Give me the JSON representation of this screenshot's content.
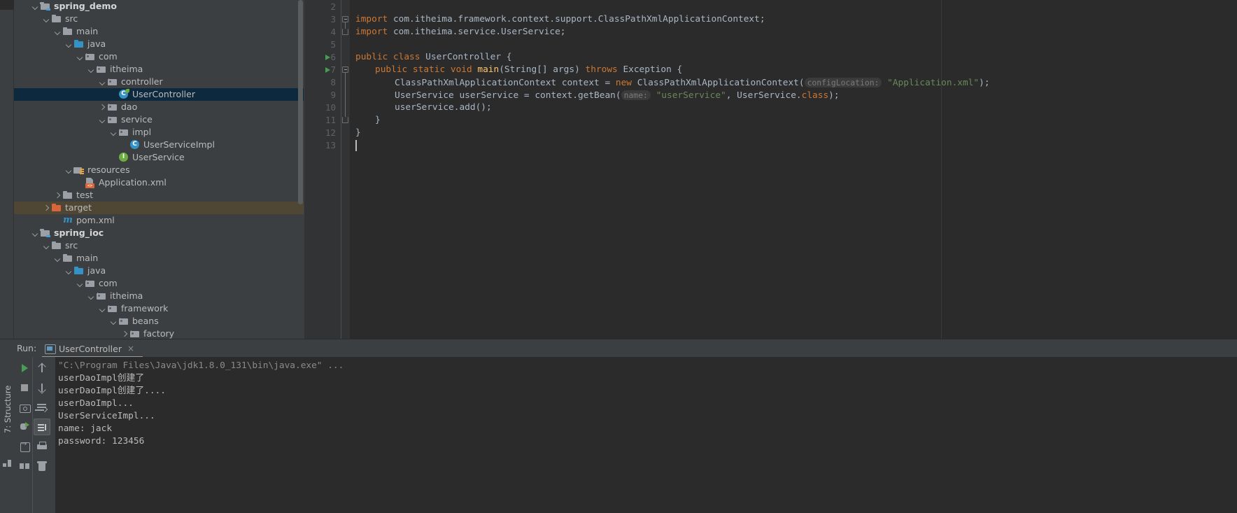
{
  "window": {
    "theme_bg": "#3c3f41",
    "editor_bg": "#2b2b2b",
    "selection_color": "#0d293e",
    "accent_blue": "#3592c4",
    "accent_green": "#6cae3e",
    "accent_orange": "#d9663a"
  },
  "project_tree": {
    "items": [
      {
        "label": "spring_demo",
        "indent": 0,
        "arrow": "down",
        "icon": "module-folder-icon",
        "bold": true,
        "state": "normal"
      },
      {
        "label": "src",
        "indent": 1,
        "arrow": "down",
        "icon": "folder-icon",
        "bold": false,
        "state": "normal"
      },
      {
        "label": "main",
        "indent": 2,
        "arrow": "down",
        "icon": "folder-icon",
        "bold": false,
        "state": "normal"
      },
      {
        "label": "java",
        "indent": 3,
        "arrow": "down",
        "icon": "source-root-icon",
        "bold": false,
        "state": "normal"
      },
      {
        "label": "com",
        "indent": 4,
        "arrow": "down",
        "icon": "package-icon",
        "bold": false,
        "state": "normal"
      },
      {
        "label": "itheima",
        "indent": 5,
        "arrow": "down",
        "icon": "package-icon",
        "bold": false,
        "state": "normal"
      },
      {
        "label": "controller",
        "indent": 6,
        "arrow": "down",
        "icon": "package-icon",
        "bold": false,
        "state": "normal"
      },
      {
        "label": "UserController",
        "indent": 7,
        "arrow": "none",
        "icon": "java-class-spring-icon",
        "bold": false,
        "state": "selected"
      },
      {
        "label": "dao",
        "indent": 6,
        "arrow": "right",
        "icon": "package-icon",
        "bold": false,
        "state": "normal"
      },
      {
        "label": "service",
        "indent": 6,
        "arrow": "down",
        "icon": "package-icon",
        "bold": false,
        "state": "normal"
      },
      {
        "label": "impl",
        "indent": 7,
        "arrow": "down",
        "icon": "package-icon",
        "bold": false,
        "state": "normal"
      },
      {
        "label": "UserServiceImpl",
        "indent": 8,
        "arrow": "none",
        "icon": "java-class-icon",
        "bold": false,
        "state": "normal"
      },
      {
        "label": "UserService",
        "indent": 7,
        "arrow": "none",
        "icon": "java-interface-icon",
        "bold": false,
        "state": "normal"
      },
      {
        "label": "resources",
        "indent": 3,
        "arrow": "down",
        "icon": "resources-folder-icon",
        "bold": false,
        "state": "normal"
      },
      {
        "label": "Application.xml",
        "indent": 4,
        "arrow": "none",
        "icon": "xml-file-icon",
        "bold": false,
        "state": "normal"
      },
      {
        "label": "test",
        "indent": 2,
        "arrow": "right",
        "icon": "folder-icon",
        "bold": false,
        "state": "normal"
      },
      {
        "label": "target",
        "indent": 1,
        "arrow": "right",
        "icon": "target-folder-icon",
        "bold": false,
        "state": "excluded"
      },
      {
        "label": "pom.xml",
        "indent": 2,
        "arrow": "none",
        "icon": "maven-pom-icon",
        "bold": false,
        "state": "normal"
      },
      {
        "label": "spring_ioc",
        "indent": 0,
        "arrow": "down",
        "icon": "module-folder-icon",
        "bold": true,
        "state": "normal"
      },
      {
        "label": "src",
        "indent": 1,
        "arrow": "down",
        "icon": "folder-icon",
        "bold": false,
        "state": "normal"
      },
      {
        "label": "main",
        "indent": 2,
        "arrow": "down",
        "icon": "folder-icon",
        "bold": false,
        "state": "normal"
      },
      {
        "label": "java",
        "indent": 3,
        "arrow": "down",
        "icon": "source-root-icon",
        "bold": false,
        "state": "normal"
      },
      {
        "label": "com",
        "indent": 4,
        "arrow": "down",
        "icon": "package-icon",
        "bold": false,
        "state": "normal"
      },
      {
        "label": "itheima",
        "indent": 5,
        "arrow": "down",
        "icon": "package-icon",
        "bold": false,
        "state": "normal"
      },
      {
        "label": "framework",
        "indent": 6,
        "arrow": "down",
        "icon": "package-icon",
        "bold": false,
        "state": "normal"
      },
      {
        "label": "beans",
        "indent": 7,
        "arrow": "down",
        "icon": "package-icon",
        "bold": false,
        "state": "normal"
      },
      {
        "label": "factory",
        "indent": 8,
        "arrow": "right",
        "icon": "package-icon",
        "bold": false,
        "state": "normal"
      }
    ]
  },
  "editor": {
    "first_visible_line": 2,
    "lines": [
      {
        "number": 2,
        "runnable": false,
        "tokens": []
      },
      {
        "number": 3,
        "runnable": false,
        "tokens": [
          {
            "t": "kw",
            "s": "import"
          },
          {
            "t": "pl",
            "s": " com.itheima.framework.context.support.ClassPathXmlApplicationContext;"
          }
        ],
        "indent": 0
      },
      {
        "number": 4,
        "runnable": false,
        "tokens": [
          {
            "t": "kw",
            "s": "import"
          },
          {
            "t": "pl",
            "s": " com.itheima.service.UserService;"
          }
        ],
        "indent": 0
      },
      {
        "number": 5,
        "runnable": false,
        "tokens": []
      },
      {
        "number": 6,
        "runnable": true,
        "tokens": [
          {
            "t": "kw",
            "s": "public class "
          },
          {
            "t": "pl",
            "s": "UserController {"
          }
        ],
        "indent": 0
      },
      {
        "number": 7,
        "runnable": true,
        "tokens": [
          {
            "t": "kw",
            "s": "public static void "
          },
          {
            "t": "mth",
            "s": "main"
          },
          {
            "t": "pl",
            "s": "(String[] args) "
          },
          {
            "t": "kw",
            "s": "throws "
          },
          {
            "t": "pl",
            "s": "Exception {"
          }
        ],
        "indent": 1
      },
      {
        "number": 8,
        "runnable": false,
        "tokens": [
          {
            "t": "pl",
            "s": "ClassPathXmlApplicationContext context = "
          },
          {
            "t": "kw",
            "s": "new "
          },
          {
            "t": "pl",
            "s": "ClassPathXmlApplicationContext("
          },
          {
            "t": "hint",
            "s": "configLocation:"
          },
          {
            "t": "str",
            "s": " \"Application.xml\""
          },
          {
            "t": "pl",
            "s": ");"
          }
        ],
        "indent": 2
      },
      {
        "number": 9,
        "runnable": false,
        "tokens": [
          {
            "t": "pl",
            "s": "UserService userService = context.getBean("
          },
          {
            "t": "hint",
            "s": "name:"
          },
          {
            "t": "str",
            "s": " \"userService\""
          },
          {
            "t": "pl",
            "s": ", UserService."
          },
          {
            "t": "kw",
            "s": "class"
          },
          {
            "t": "pl",
            "s": ");"
          }
        ],
        "indent": 2
      },
      {
        "number": 10,
        "runnable": false,
        "tokens": [
          {
            "t": "pl",
            "s": "userService.add();"
          }
        ],
        "indent": 2
      },
      {
        "number": 11,
        "runnable": false,
        "tokens": [
          {
            "t": "pl",
            "s": "}"
          }
        ],
        "indent": 1
      },
      {
        "number": 12,
        "runnable": false,
        "tokens": [
          {
            "t": "pl",
            "s": "}"
          }
        ],
        "indent": 0
      },
      {
        "number": 13,
        "runnable": false,
        "tokens": [],
        "caret": true
      }
    ]
  },
  "run_panel": {
    "run_label": "Run:",
    "tab": {
      "name": "UserController",
      "icon": "run-configuration-icon",
      "close": "×"
    },
    "toolbar_left": [
      {
        "icon": "rerun-play-icon",
        "selected": false
      },
      {
        "icon": "stop-icon",
        "selected": false
      },
      {
        "icon": "screenshot-camera-icon",
        "selected": false
      },
      {
        "icon": "debug-bug-icon",
        "selected": false
      },
      {
        "icon": "export-import-icon",
        "selected": false
      },
      {
        "icon": "layout-icon",
        "selected": false
      }
    ],
    "toolbar_right": [
      {
        "icon": "arrow-up-icon",
        "selected": false
      },
      {
        "icon": "arrow-down-icon",
        "selected": false
      },
      {
        "icon": "soft-wrap-icon",
        "selected": false
      },
      {
        "icon": "scroll-to-end-icon",
        "selected": true
      },
      {
        "icon": "print-icon",
        "selected": false
      },
      {
        "icon": "trash-icon",
        "selected": false
      }
    ],
    "console_lines": [
      {
        "text": "\"C:\\Program Files\\Java\\jdk1.8.0_131\\bin\\java.exe\" ...",
        "style": "system"
      },
      {
        "text": "userDaoImpl创建了",
        "style": "normal"
      },
      {
        "text": "userDaoImpl创建了....",
        "style": "normal"
      },
      {
        "text": "userDaoImpl...",
        "style": "normal"
      },
      {
        "text": "UserServiceImpl...",
        "style": "normal"
      },
      {
        "text": "name: jack",
        "style": "normal"
      },
      {
        "text": "password: 123456",
        "style": "normal"
      }
    ]
  },
  "status_strip": {
    "structure_label": "7: Structure"
  }
}
